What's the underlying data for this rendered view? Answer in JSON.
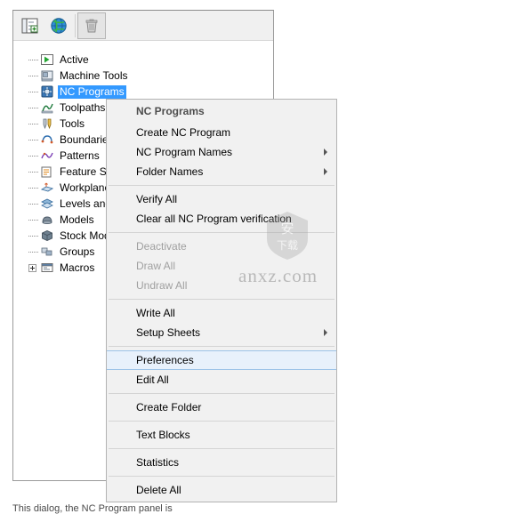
{
  "window": {
    "toolbar": {
      "buttons": [
        {
          "name": "explorer-tree-icon",
          "label": ""
        },
        {
          "name": "globe-icon",
          "label": ""
        },
        {
          "name": "trash-icon",
          "label": ""
        }
      ]
    }
  },
  "tree": {
    "items": [
      {
        "label": "Active",
        "icon": "green-arrow-icon",
        "expandable": false,
        "selected": false
      },
      {
        "label": "Machine Tools",
        "icon": "machine-tool-icon",
        "expandable": false,
        "selected": false
      },
      {
        "label": "NC Programs",
        "icon": "nc-program-icon",
        "expandable": false,
        "selected": true
      },
      {
        "label": "Toolpaths",
        "icon": "toolpath-icon",
        "expandable": false,
        "selected": false
      },
      {
        "label": "Tools",
        "icon": "tools-icon",
        "expandable": false,
        "selected": false
      },
      {
        "label": "Boundaries",
        "icon": "boundary-icon",
        "expandable": false,
        "selected": false
      },
      {
        "label": "Patterns",
        "icon": "pattern-icon",
        "expandable": false,
        "selected": false
      },
      {
        "label": "Feature Sets",
        "icon": "feature-set-icon",
        "expandable": false,
        "selected": false
      },
      {
        "label": "Workplanes",
        "icon": "workplane-icon",
        "expandable": false,
        "selected": false
      },
      {
        "label": "Levels and Sets",
        "icon": "levels-sets-icon",
        "expandable": false,
        "selected": false
      },
      {
        "label": "Models",
        "icon": "model-icon",
        "expandable": false,
        "selected": false
      },
      {
        "label": "Stock Models",
        "icon": "stock-model-icon",
        "expandable": false,
        "selected": false
      },
      {
        "label": "Groups",
        "icon": "group-icon",
        "expandable": false,
        "selected": false
      },
      {
        "label": "Macros",
        "icon": "macro-icon",
        "expandable": true,
        "selected": false
      }
    ]
  },
  "context_menu": {
    "title": "NC Programs",
    "items": [
      {
        "label": "Create NC Program",
        "submenu": false,
        "disabled": false,
        "highlight": false,
        "separator_after": false
      },
      {
        "label": "NC Program Names",
        "submenu": true,
        "disabled": false,
        "highlight": false,
        "separator_after": false
      },
      {
        "label": "Folder Names",
        "submenu": true,
        "disabled": false,
        "highlight": false,
        "separator_after": true
      },
      {
        "label": "Verify All",
        "submenu": false,
        "disabled": false,
        "highlight": false,
        "separator_after": false
      },
      {
        "label": "Clear all NC Program verification",
        "submenu": false,
        "disabled": false,
        "highlight": false,
        "separator_after": true
      },
      {
        "label": "Deactivate",
        "submenu": false,
        "disabled": true,
        "highlight": false,
        "separator_after": false
      },
      {
        "label": "Draw All",
        "submenu": false,
        "disabled": true,
        "highlight": false,
        "separator_after": false
      },
      {
        "label": "Undraw All",
        "submenu": false,
        "disabled": true,
        "highlight": false,
        "separator_after": true
      },
      {
        "label": "Write All",
        "submenu": false,
        "disabled": false,
        "highlight": false,
        "separator_after": false
      },
      {
        "label": "Setup Sheets",
        "submenu": true,
        "disabled": false,
        "highlight": false,
        "separator_after": true
      },
      {
        "label": "Preferences",
        "submenu": false,
        "disabled": false,
        "highlight": true,
        "separator_after": false
      },
      {
        "label": "Edit All",
        "submenu": false,
        "disabled": false,
        "highlight": false,
        "separator_after": true
      },
      {
        "label": "Create Folder",
        "submenu": false,
        "disabled": false,
        "highlight": false,
        "separator_after": true
      },
      {
        "label": "Text Blocks",
        "submenu": false,
        "disabled": false,
        "highlight": false,
        "separator_after": true
      },
      {
        "label": "Statistics",
        "submenu": false,
        "disabled": false,
        "highlight": false,
        "separator_after": true
      },
      {
        "label": "Delete All",
        "submenu": false,
        "disabled": false,
        "highlight": false,
        "separator_after": false
      }
    ]
  },
  "watermark": {
    "text": "anxz.com",
    "badge_text": "安下载"
  },
  "caption": {
    "text": "This dialog, the NC Program panel is"
  },
  "colors": {
    "selection": "#3399ff",
    "highlight_bg": "#e8f1fb",
    "highlight_border": "#9dc4e8",
    "menu_bg": "#f1f1f1",
    "panel_border": "#9b9b9b"
  }
}
